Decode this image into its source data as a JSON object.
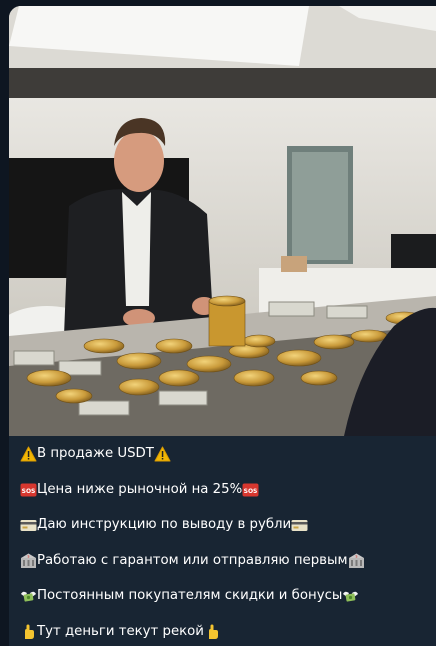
{
  "message": {
    "photo_alt": "",
    "lines": [
      {
        "icon_left": "warning-icon",
        "text": "В продаже USDT",
        "icon_right": "warning-icon"
      },
      {
        "icon_left": "sos-icon",
        "text": "Цена ниже рыночной на 25%",
        "icon_right": "sos-icon"
      },
      {
        "icon_left": "credit-card-icon",
        "text": "Даю инструкцию по выводу в рубли",
        "icon_right": "credit-card-icon"
      },
      {
        "icon_left": "bank-icon",
        "text": "Работаю с гарантом или отправляю первым",
        "icon_right": "bank-icon"
      },
      {
        "icon_left": "money-wings-icon",
        "text": "Постоянным покупателям скидки и бонусы",
        "icon_right": "money-wings-icon"
      },
      {
        "icon_left": "hand-icon",
        "text": "Тут деньги текут рекой",
        "icon_right": "hand-icon"
      }
    ]
  },
  "colors": {
    "background": "#0e1621",
    "bubble": "#182533",
    "text": "#ffffff"
  }
}
